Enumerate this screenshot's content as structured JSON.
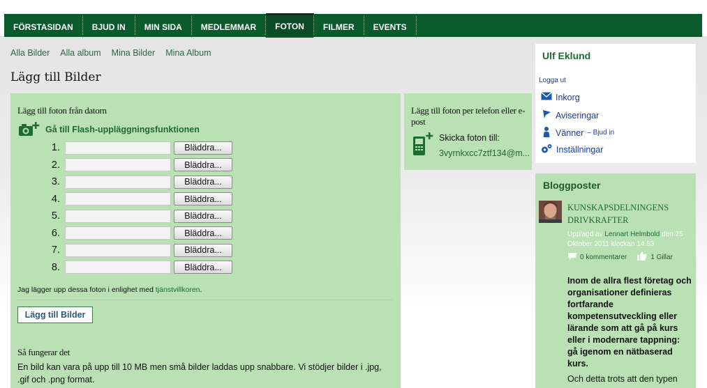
{
  "nav": {
    "items": [
      "FÖRSTASIDAN",
      "BJUD IN",
      "MIN SIDA",
      "MEDLEMMAR",
      "FOTON",
      "FILMER",
      "EVENTS"
    ],
    "active_index": 4
  },
  "subnav": [
    "Alla Bilder",
    "Alla album",
    "Mina Bilder",
    "Mina Album"
  ],
  "page_title": "Lägg till Bilder",
  "upload": {
    "heading": "Lägg till foton från datorn",
    "flash_link": "Gå till Flash-uppläggningsfunktionen",
    "rows": [
      {
        "num": "1.",
        "button": "Bläddra..."
      },
      {
        "num": "2.",
        "button": "Bläddra..."
      },
      {
        "num": "3.",
        "button": "Bläddra..."
      },
      {
        "num": "4.",
        "button": "Bläddra..."
      },
      {
        "num": "5.",
        "button": "Bläddra..."
      },
      {
        "num": "6.",
        "button": "Bläddra..."
      },
      {
        "num": "7.",
        "button": "Bläddra..."
      },
      {
        "num": "8.",
        "button": "Bläddra..."
      }
    ],
    "terms_prefix": "Jag lägger upp dessa foton i enlighet med ",
    "terms_link": "tjänstvillkoren",
    "terms_suffix": ".",
    "submit": "Lägg till Bilder",
    "how_heading": "Så fungerar det",
    "how_text": "En bild kan vara på upp till 10 MB men små bilder laddas upp snabbare. Vi stödjer bilder i .jpg, .gif och .png format."
  },
  "phone": {
    "heading": "Lägg till foton per telefon eller e-post",
    "send_label": "Skicka foton till:",
    "email": "3vyrnkxcc7ztf134@m..."
  },
  "user": {
    "name": "Ulf Eklund",
    "logout": "Logga ut",
    "links": [
      {
        "label": "Inkorg",
        "icon": "envelope-icon"
      },
      {
        "label": "Aviseringar",
        "icon": "flag-icon"
      },
      {
        "label": "Vänner",
        "extra": "– Bjud in",
        "icon": "person-icon"
      },
      {
        "label": "Inställningar",
        "icon": "gear-icon"
      }
    ]
  },
  "blog": {
    "title": "Bloggposter",
    "post_title": "KUNSKAPSDELNINGENS DRIVKRAFTER",
    "meta_prefix": "Upplagd av ",
    "author": "Lennart Helmbold",
    "meta_suffix": " den 25 Oktober 2011 klockan 14.53",
    "comments": "0 kommentarer",
    "likes": "1 Gillar",
    "excerpt": "Inom de allra flest företag och organisationer definieras fortfarande kompetensutveckling eller lärande som att gå på kurs eller i modernare tappning: gå igenom en nätbaserad kurs.",
    "excerpt2": "Och detta trots att den typen"
  },
  "colors": {
    "nav_bg": "#0a5a2e",
    "panel_green": "#b9e1b4",
    "link_green": "#1f6a2f",
    "link_blue": "#1a3aa0"
  }
}
